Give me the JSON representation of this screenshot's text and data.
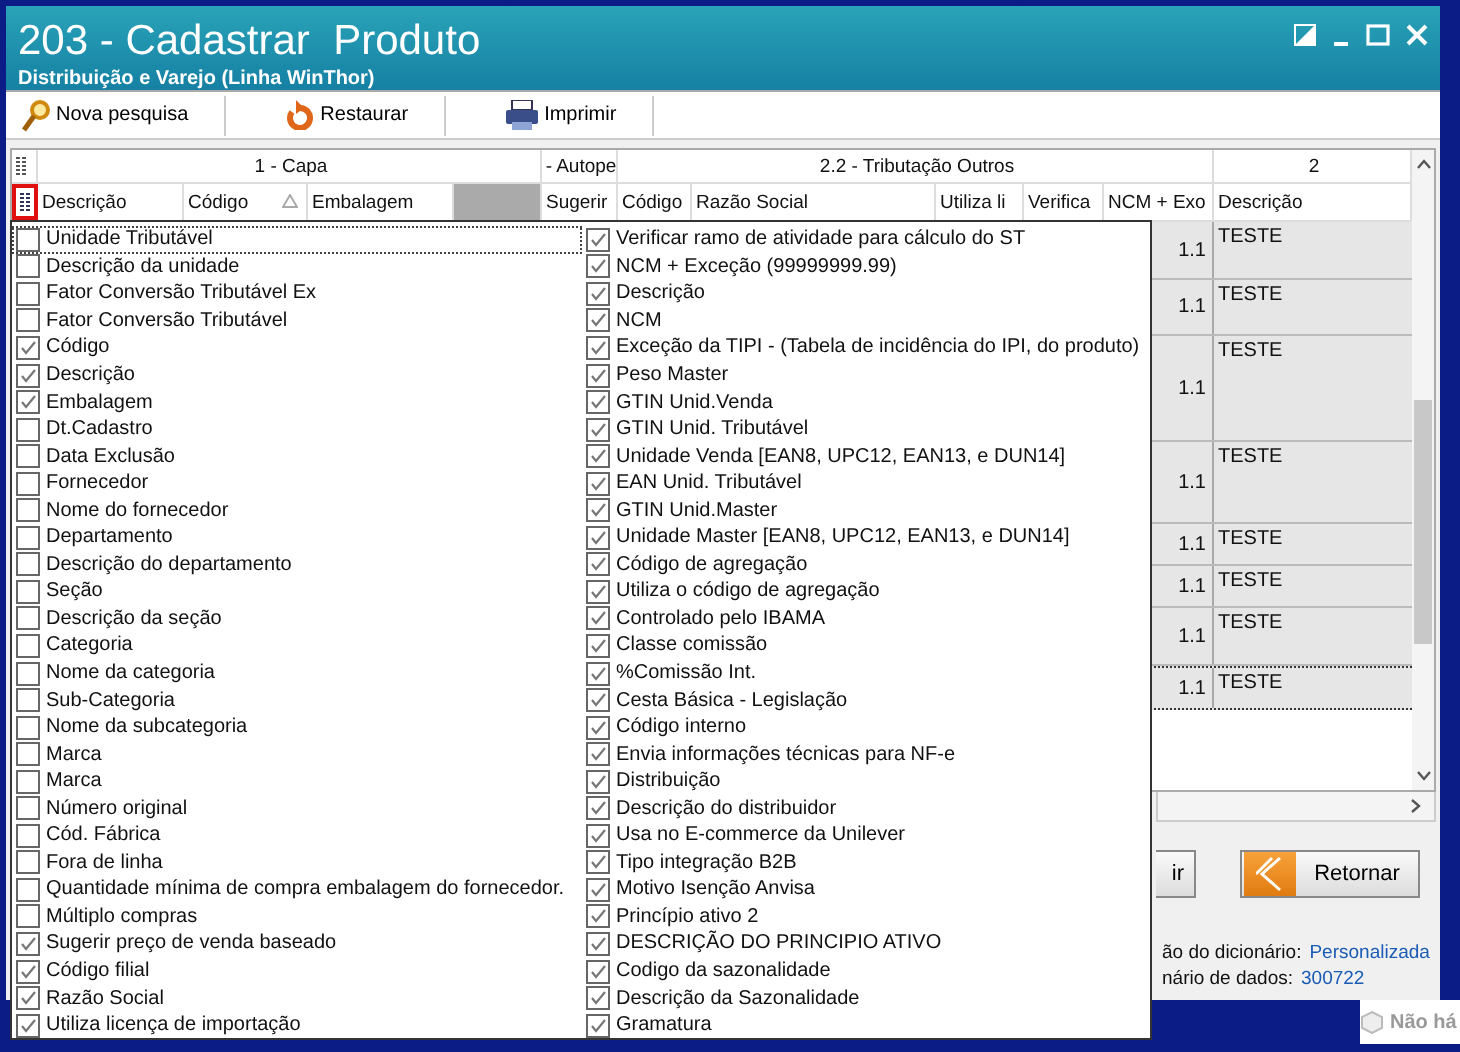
{
  "window": {
    "title": "203 - Cadastrar  Produto",
    "subtitle": "Distribuição e Varejo (Linha WinThor)"
  },
  "toolbar": [
    {
      "kind": "search",
      "label": "Nova pesquisa"
    },
    {
      "kind": "restore",
      "label": "Restaurar"
    },
    {
      "kind": "print",
      "label": "Imprimir"
    }
  ],
  "grid": {
    "group_headers": [
      {
        "label": "1 - Capa"
      },
      {
        "label": "- Autope"
      },
      {
        "label": "2.2 - Tributação Outros"
      },
      {
        "label": "2"
      }
    ],
    "columns": [
      {
        "kind": "text",
        "label": "Descrição",
        "sorted": false
      },
      {
        "kind": "text",
        "label": "Código",
        "sorted": true
      },
      {
        "kind": "text",
        "label": "Embalagem",
        "sorted": false
      },
      {
        "kind": "blank"
      },
      {
        "kind": "text",
        "label": "Sugerir",
        "sorted": false
      },
      {
        "kind": "text",
        "label": "Código",
        "sorted": false
      },
      {
        "kind": "text",
        "label": "Razão Social",
        "sorted": false
      },
      {
        "kind": "text",
        "label": "Utiliza li",
        "sorted": false
      },
      {
        "kind": "text",
        "label": "Verifica",
        "sorted": false
      },
      {
        "kind": "text",
        "label": "NCM + Exo",
        "sorted": false
      },
      {
        "kind": "text",
        "label": "Descrição",
        "sorted": false
      }
    ],
    "rows": [
      {
        "ncm": "1.1",
        "descricao": "TESTE",
        "focused": false
      },
      {
        "ncm": "1.1",
        "descricao": "TESTE",
        "focused": false
      },
      {
        "ncm": "1.1",
        "descricao": "TESTE",
        "focused": false
      },
      {
        "ncm": "1.1",
        "descricao": "TESTE",
        "focused": false
      },
      {
        "ncm": "1.1",
        "descricao": "TESTE",
        "focused": false
      },
      {
        "ncm": "1.1",
        "descricao": "TESTE",
        "focused": false
      },
      {
        "ncm": "1.1",
        "descricao": "TESTE",
        "focused": false
      },
      {
        "ncm": "1.1",
        "descricao": "TESTE",
        "focused": true
      }
    ]
  },
  "column_chooser": [
    {
      "label": "Unidade Tributável",
      "checked": false
    },
    {
      "label": "Descrição da unidade",
      "checked": false
    },
    {
      "label": "Fator Conversão Tributável Ex",
      "checked": false
    },
    {
      "label": "Fator Conversão Tributável",
      "checked": false
    },
    {
      "label": "Código",
      "checked": true
    },
    {
      "label": "Descrição",
      "checked": true
    },
    {
      "label": "Embalagem",
      "checked": true
    },
    {
      "label": "Dt.Cadastro",
      "checked": false
    },
    {
      "label": "Data Exclusão",
      "checked": false
    },
    {
      "label": "Fornecedor",
      "checked": false
    },
    {
      "label": "Nome do fornecedor",
      "checked": false
    },
    {
      "label": "Departamento",
      "checked": false
    },
    {
      "label": "Descrição do departamento",
      "checked": false
    },
    {
      "label": "Seção",
      "checked": false
    },
    {
      "label": "Descrição da seção",
      "checked": false
    },
    {
      "label": "Categoria",
      "checked": false
    },
    {
      "label": "Nome da categoria",
      "checked": false
    },
    {
      "label": "Sub-Categoria",
      "checked": false
    },
    {
      "label": "Nome da subcategoria",
      "checked": false
    },
    {
      "label": "Marca",
      "checked": false
    },
    {
      "label": "Marca",
      "checked": false
    },
    {
      "label": "Número original",
      "checked": false
    },
    {
      "label": "Cód. Fábrica",
      "checked": false
    },
    {
      "label": "Fora de linha",
      "checked": false
    },
    {
      "label": "Quantidade mínima de compra embalagem do fornecedor.",
      "checked": false
    },
    {
      "label": "Múltiplo compras",
      "checked": false
    },
    {
      "label": "Sugerir preço de venda baseado",
      "checked": true
    },
    {
      "label": "Código filial",
      "checked": true
    },
    {
      "label": "Razão Social",
      "checked": true
    },
    {
      "label": "Utiliza licença de importação",
      "checked": true
    },
    {
      "label": "Verificar ramo de atividade para cálculo do ST",
      "checked": true
    },
    {
      "label": "NCM + Exceção (99999999.99)",
      "checked": true
    },
    {
      "label": "Descrição",
      "checked": true
    },
    {
      "label": "NCM",
      "checked": true
    },
    {
      "label": "Exceção da TIPI - (Tabela de incidência do IPI, do produto)",
      "checked": true
    },
    {
      "label": "Peso Master",
      "checked": true
    },
    {
      "label": "GTIN Unid.Venda",
      "checked": true
    },
    {
      "label": "GTIN Unid. Tributável",
      "checked": true
    },
    {
      "label": "Unidade Venda [EAN8, UPC12, EAN13, e DUN14]",
      "checked": true
    },
    {
      "label": "EAN Unid. Tributável",
      "checked": true
    },
    {
      "label": "GTIN Unid.Master",
      "checked": true
    },
    {
      "label": "Unidade Master [EAN8, UPC12, EAN13, e DUN14]",
      "checked": true
    },
    {
      "label": "Código de agregação",
      "checked": true
    },
    {
      "label": "Utiliza o código de agregação",
      "checked": true
    },
    {
      "label": "Controlado pelo IBAMA",
      "checked": true
    },
    {
      "label": "Classe comissão",
      "checked": true
    },
    {
      "label": "%Comissão Int.",
      "checked": true
    },
    {
      "label": "Cesta Básica - Legislação",
      "checked": true
    },
    {
      "label": "Código interno",
      "checked": true
    },
    {
      "label": "Envia informações técnicas para NF-e",
      "checked": true
    },
    {
      "label": "Distribuição",
      "checked": true
    },
    {
      "label": "Descrição do distribuidor",
      "checked": true
    },
    {
      "label": "Usa no E-commerce da Unilever",
      "checked": true
    },
    {
      "label": "Tipo integração B2B",
      "checked": true
    },
    {
      "label": "Motivo Isenção Anvisa",
      "checked": true
    },
    {
      "label": "Princípio ativo 2",
      "checked": true
    },
    {
      "label": "DESCRIÇÃO DO PRINCIPIO ATIVO",
      "checked": true
    },
    {
      "label": "Codigo da sazonalidade",
      "checked": true
    },
    {
      "label": "Descrição da Sazonalidade",
      "checked": true
    },
    {
      "label": "Gramatura",
      "checked": true
    }
  ],
  "footer": {
    "buttons": [
      {
        "kind": "plain",
        "label": "ir"
      },
      {
        "kind": "back",
        "label": "Retornar"
      }
    ],
    "info": [
      {
        "label": "ão do dicionário:",
        "value": "Personalizada"
      },
      {
        "label": "nário de dados:",
        "value": "300722"
      }
    ]
  },
  "desktop": {
    "text": "Não há"
  }
}
